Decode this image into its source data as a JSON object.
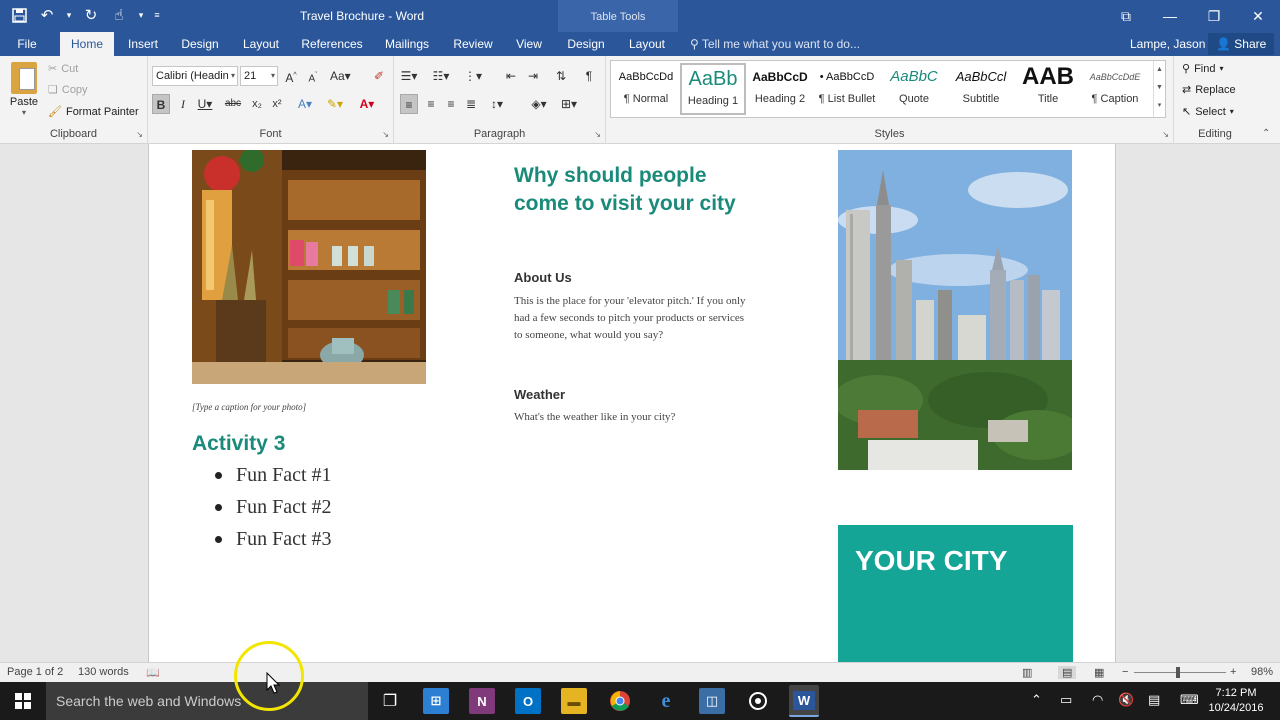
{
  "window": {
    "title": "Travel Brochure - Word",
    "context_tab": "Table Tools"
  },
  "tabs": [
    "File",
    "Home",
    "Insert",
    "Design",
    "Layout",
    "References",
    "Mailings",
    "Review",
    "View",
    "Design",
    "Layout"
  ],
  "tell_me": "Tell me what you want to do...",
  "user": "Lampe, Jason",
  "share": "Share",
  "clipboard": {
    "paste": "Paste",
    "cut": "Cut",
    "copy": "Copy",
    "format_painter": "Format Painter",
    "label": "Clipboard"
  },
  "font": {
    "name": "Calibri (Headin",
    "size": "21",
    "label": "Font"
  },
  "paragraph": {
    "label": "Paragraph"
  },
  "styles": {
    "label": "Styles",
    "items": [
      {
        "preview": "AaBbCcDd",
        "name": "¶ Normal"
      },
      {
        "preview": "AaBb",
        "name": "Heading 1"
      },
      {
        "preview": "AaBbCcD",
        "name": "Heading 2"
      },
      {
        "preview": "• AaBbCcD",
        "name": "¶ List Bullet"
      },
      {
        "preview": "AaBbC",
        "name": "Quote"
      },
      {
        "preview": "AaBbCcl",
        "name": "Subtitle"
      },
      {
        "preview": "AAB",
        "name": "Title"
      },
      {
        "preview": "AaBbCcDdE",
        "name": "¶ Caption"
      }
    ]
  },
  "editing": {
    "find": "Find",
    "replace": "Replace",
    "select": "Select",
    "label": "Editing"
  },
  "document": {
    "caption": "[Type a caption for your photo]",
    "activity_title": "Activity 3",
    "facts": [
      "Fun Fact #1",
      "Fun Fact #2",
      "Fun Fact #3"
    ],
    "main_heading": "Why should people come to visit your city",
    "about_title": "About Us",
    "about_body": "This is the place for your 'elevator pitch.' If you only had a few seconds to pitch your products or services to someone, what would you say?",
    "weather_title": "Weather",
    "weather_body": "What's the weather like in your city?",
    "city_box": "YOUR CITY"
  },
  "status": {
    "page": "Page 1 of 2",
    "words": "130 words",
    "zoom": "98%"
  },
  "taskbar": {
    "search": "Search the web and Windows",
    "time": "7:12 PM",
    "date": "10/24/2016"
  },
  "colors": {
    "word_blue": "#2b579a",
    "teal_heading": "#1a8a7a",
    "city_box": "#14a596"
  }
}
